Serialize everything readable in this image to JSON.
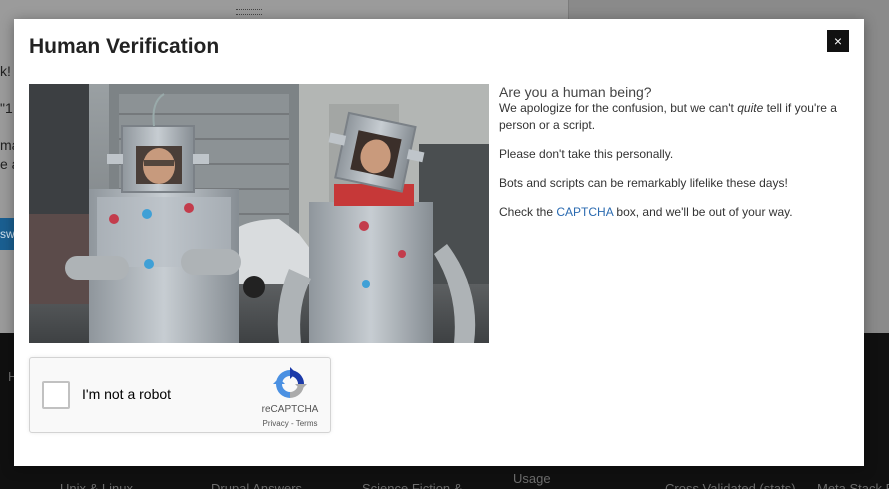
{
  "background": {
    "left_fragments": [
      "k!",
      "\"1",
      "ma",
      "e a"
    ],
    "button_fragment": "sw",
    "footer_fragments": [
      "H",
      "Unix & Linux",
      "Drupal Answers",
      "Science Fiction &",
      "Usage",
      "Cross Validated (stats)",
      "Meta Stack E"
    ]
  },
  "modal": {
    "title": "Human Verification",
    "close_label": "×",
    "heading": "Are you a human being?",
    "apology_before": "We apologize for the confusion, but we can't ",
    "apology_emphasis": "quite",
    "apology_after": " tell if you're a person or a script.",
    "paragraph_2": "Please don't take this personally.",
    "paragraph_3": "Bots and scripts can be remarkably lifelike these days!",
    "check_before": "Check the ",
    "check_link": "CAPTCHA",
    "check_after": " box, and we'll be out of your way."
  },
  "recaptcha": {
    "label": "I'm not a robot",
    "brand": "reCAPTCHA",
    "privacy": "Privacy",
    "separator": " - ",
    "terms": "Terms",
    "checked": false
  },
  "colors": {
    "link": "#2a6ab0",
    "close_bg": "#111111",
    "recaptcha_blue": "#1c3aa9",
    "recaptcha_light_blue": "#4a90e2",
    "recaptcha_gray": "#ababab"
  }
}
